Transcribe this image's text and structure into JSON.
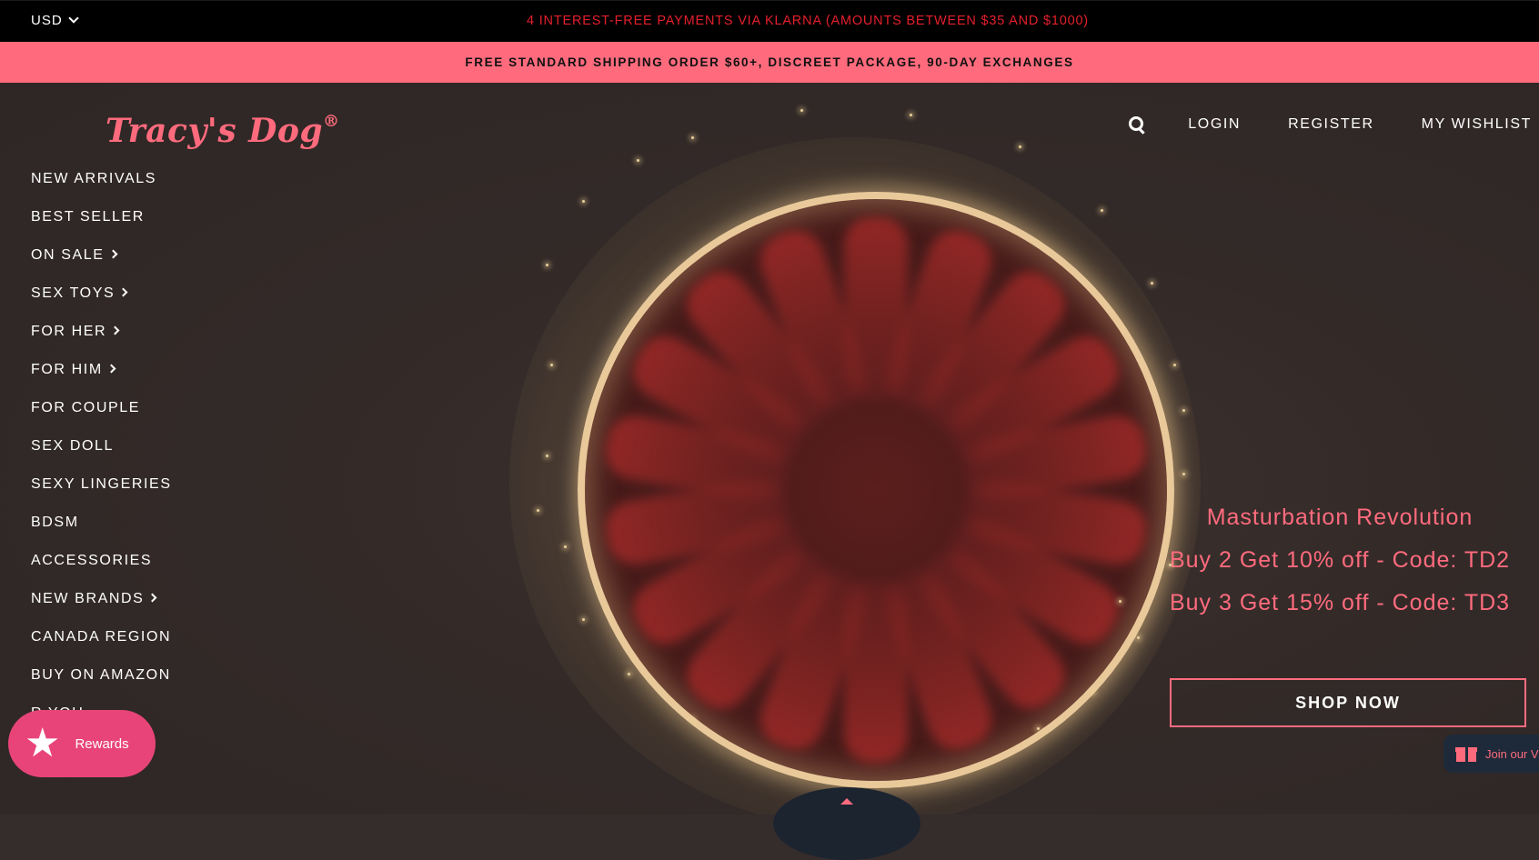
{
  "topbar": {
    "currency": "USD",
    "announcement": "4 INTEREST-FREE PAYMENTS VIA KLARNA (AMOUNTS BETWEEN $35 AND $1000)"
  },
  "shipbar": {
    "text": "FREE STANDARD SHIPPING ORDER $60+, DISCREET PACKAGE, 90-DAY EXCHANGES"
  },
  "brand": {
    "name": "Tracy's Dog",
    "registered": "®",
    "color": "#ff6b7d"
  },
  "header": {
    "login": "LOGIN",
    "register": "REGISTER",
    "wishlist": "MY WISHLIST"
  },
  "nav": {
    "items": [
      {
        "label": "NEW ARRIVALS",
        "has_submenu": false
      },
      {
        "label": "BEST SELLER",
        "has_submenu": false
      },
      {
        "label": "ON SALE",
        "has_submenu": true
      },
      {
        "label": "SEX TOYS",
        "has_submenu": true
      },
      {
        "label": "FOR HER",
        "has_submenu": true
      },
      {
        "label": "FOR HIM",
        "has_submenu": true
      },
      {
        "label": "FOR COUPLE",
        "has_submenu": false
      },
      {
        "label": "SEX DOLL",
        "has_submenu": false
      },
      {
        "label": "SEXY LINGERIES",
        "has_submenu": false
      },
      {
        "label": "BDSM",
        "has_submenu": false
      },
      {
        "label": "ACCESSORIES",
        "has_submenu": false
      },
      {
        "label": "NEW BRANDS",
        "has_submenu": true
      },
      {
        "label": "CANADA REGION",
        "has_submenu": false
      },
      {
        "label": "BUY ON AMAZON",
        "has_submenu": false
      },
      {
        "label": "R YOU",
        "has_submenu": false
      }
    ]
  },
  "promo": {
    "headline": "Masturbation Revolution",
    "line1": "Buy 2 Get 10% off - Code: TD2",
    "line2": "Buy 3 Get 15% off - Code: TD3",
    "cta": "SHOP NOW"
  },
  "widgets": {
    "rewards": "Rewards",
    "vip": "Join our VI"
  },
  "colors": {
    "accent": "#ff6b7d",
    "klarna_text": "#e4202c",
    "rewards_bg": "#e8447a"
  }
}
